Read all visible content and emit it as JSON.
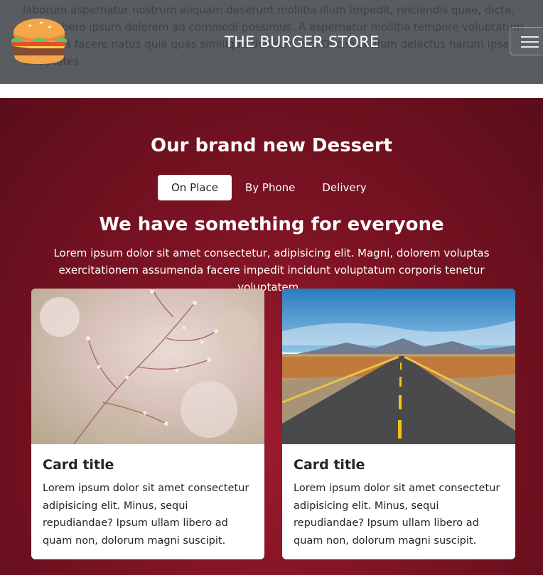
{
  "header": {
    "brand_name": "THE BURGER STORE",
    "logo_icon": "burger-icon",
    "menu_icon": "hamburger-menu-icon",
    "background_text": "laborum aspernatur nostrum aliquam deserunt mollitia illum impedit, reiciendis quae, dicta, animi libero ipsum dolorem ad commodi possimus. A aspernatur mollitia tempore voluptatum blanditiis facere natus quia quas similique dolorum hic. Ducimus illum delectus harum ipsa voluptates."
  },
  "dessert": {
    "title": "Our brand new Dessert",
    "tabs": [
      {
        "label": "On Place",
        "active": true
      },
      {
        "label": "By Phone",
        "active": false
      },
      {
        "label": "Delivery",
        "active": false
      }
    ],
    "headline": "We have something for everyone",
    "lead": "Lorem ipsum dolor sit amet consectetur, adipisicing elit. Magni, dolorem voluptas exercitationem assumenda facere impedit incidunt voluptatum corporis tenetur voluptatem..",
    "cards": [
      {
        "title": "Card title",
        "text": "Lorem ipsum dolor sit amet consectetur adipisicing elit. Minus, sequi repudiandae? Ipsum ullam libero ad quam non, dolorum magni suscipit.",
        "image": "blossom-branches-photo"
      },
      {
        "title": "Card title",
        "text": "Lorem ipsum dolor sit amet consectetur adipisicing elit. Minus, sequi repudiandae? Ipsum ullam libero ad quam non, dolorum magni suscipit.",
        "image": "desert-road-photo"
      }
    ]
  },
  "colors": {
    "header_bg": "#595c61",
    "section_bg": "#7c1323",
    "accent": "#9c1b2e"
  }
}
